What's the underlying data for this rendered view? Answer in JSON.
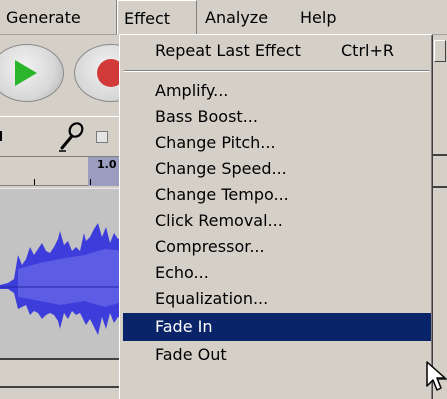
{
  "menubar": {
    "generate": "Generate",
    "effect": "Effect",
    "analyze": "Analyze",
    "help": "Help"
  },
  "ruler": {
    "label": "1.0"
  },
  "effect_menu": {
    "repeat": {
      "label": "Repeat Last Effect",
      "shortcut": "Ctrl+R"
    },
    "items": [
      "Amplify...",
      "Bass Boost...",
      "Change Pitch...",
      "Change Speed...",
      "Change Tempo...",
      "Click Removal...",
      "Compressor...",
      "Echo...",
      "Equalization...",
      "Fade In",
      "Fade Out"
    ],
    "selected": "Fade In"
  },
  "colors": {
    "menu_bg": "#d4d0c8",
    "highlight": "#0a246a",
    "waveform": "#3d3ddb",
    "play": "#2bb52b",
    "record": "#d23a3a"
  },
  "icons": [
    "play-icon",
    "record-icon",
    "microphone-icon",
    "mouse-pointer-icon"
  ]
}
